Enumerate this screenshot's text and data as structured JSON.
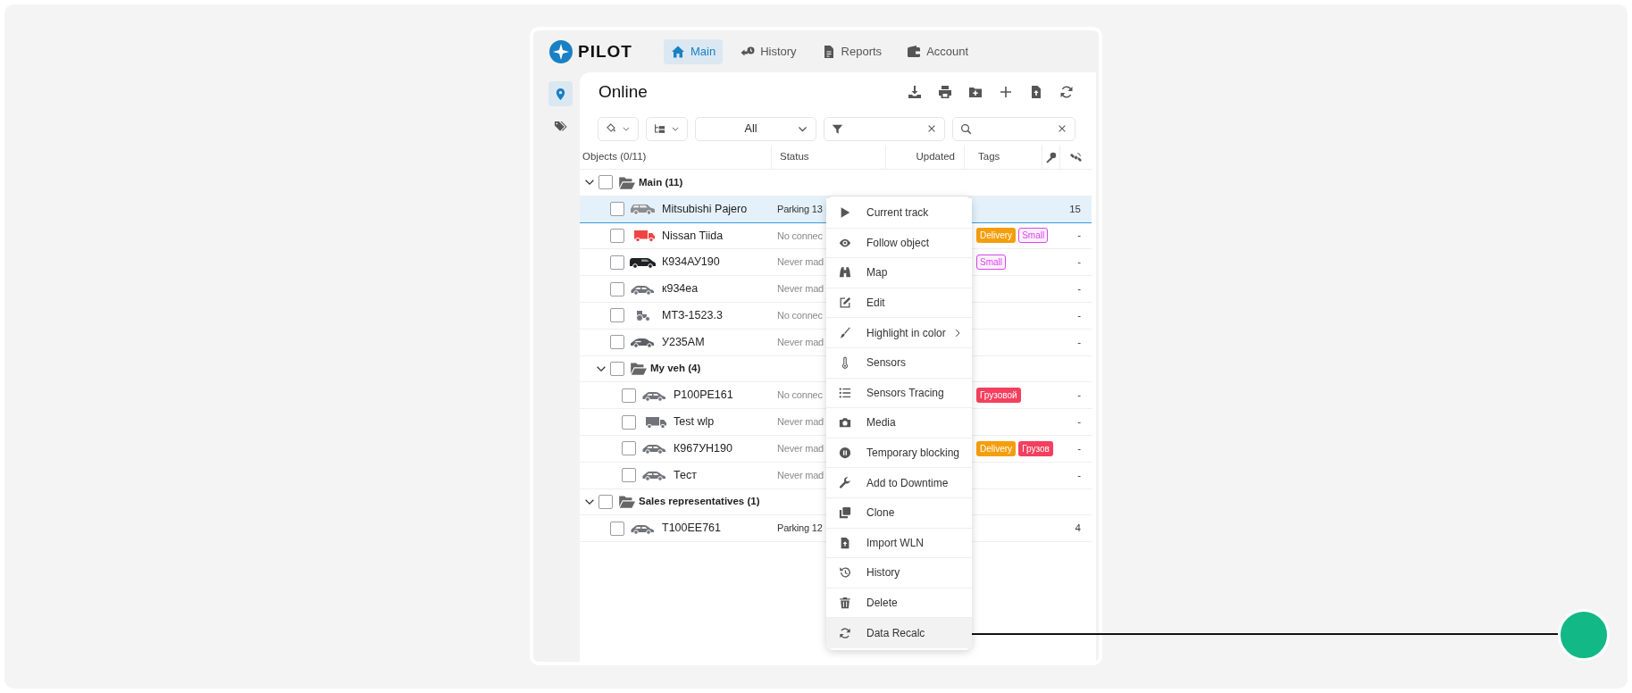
{
  "logo": {
    "text": "PILOT"
  },
  "nav_tabs": [
    {
      "label": "Main",
      "selected": true
    },
    {
      "label": "History",
      "selected": false
    },
    {
      "label": "Reports",
      "selected": false
    },
    {
      "label": "Account",
      "selected": false
    }
  ],
  "sidebar": {
    "items": [
      {
        "selected": true
      },
      {
        "selected": false
      }
    ]
  },
  "panel": {
    "title": "Online"
  },
  "filters": {
    "selector": "All"
  },
  "table": {
    "columns": [
      "Objects (0/11)",
      "Status",
      "Updated",
      "Tags"
    ],
    "rows": [
      {
        "kind": "group",
        "label": "Main (11)",
        "expanded": true,
        "checked": false,
        "children": [
          {
            "kind": "object",
            "name": "Mitsubishi Pajero",
            "color": "#8a8d93",
            "status": {
              "text": "Parking 13",
              "kind": "parking"
            },
            "value": "15",
            "checked": false,
            "selected": true
          },
          {
            "kind": "object",
            "name": "Nissan Tiida",
            "color": "#ef4444",
            "status": {
              "text": "No connec",
              "kind": "offline"
            },
            "tags": [
              {
                "text": "Delivery",
                "color": "#f59e0b",
                "kind": "solid"
              },
              {
                "text": "Small",
                "color": "#d946ef",
                "kind": "soft"
              }
            ],
            "value": "-",
            "checked": false,
            "selected": false
          },
          {
            "kind": "object",
            "name": "К934АУ190",
            "color": "#1f2023",
            "status": {
              "text": "Never mad",
              "kind": "offline"
            },
            "tags": [
              {
                "text": "Small",
                "color": "#d946ef",
                "kind": "soft"
              }
            ],
            "value": "-",
            "checked": false,
            "selected": false
          },
          {
            "kind": "object",
            "name": "к934еа",
            "color": "#71737a",
            "status": {
              "text": "Never mad",
              "kind": "offline"
            },
            "value": "-",
            "checked": false,
            "selected": false
          },
          {
            "kind": "object",
            "name": "МТЗ-1523.3",
            "color": "#71737a",
            "status": {
              "text": "No connec",
              "kind": "offline"
            },
            "value": "-",
            "checked": false,
            "selected": false
          },
          {
            "kind": "object",
            "name": "У235АМ",
            "color": "#5b5e66",
            "status": {
              "text": "Never mad",
              "kind": "offline"
            },
            "value": "-",
            "checked": false,
            "selected": false
          },
          {
            "kind": "group",
            "label": "My veh (4)",
            "expanded": true,
            "checked": false,
            "children": [
              {
                "kind": "object",
                "name": "Р100РЕ161",
                "color": "#71737a",
                "status": {
                  "text": "No connec",
                  "kind": "offline"
                },
                "tags": [
                  {
                    "text": "Грузовой",
                    "color": "#f43f5e",
                    "kind": "solid"
                  }
                ],
                "value": "-",
                "checked": false,
                "selected": false
              },
              {
                "kind": "object",
                "name": "Test wlp",
                "color": "#71737a",
                "status": {
                  "text": "Never mad",
                  "kind": "offline"
                },
                "value": "-",
                "checked": false,
                "selected": false
              },
              {
                "kind": "object",
                "name": "К967УН190",
                "color": "#71737a",
                "status": {
                  "text": "Never mad",
                  "kind": "offline"
                },
                "tags": [
                  {
                    "text": "Delivery",
                    "color": "#f59e0b",
                    "kind": "solid"
                  },
                  {
                    "text": "Грузов",
                    "color": "#f43f5e",
                    "kind": "solid"
                  }
                ],
                "value": "-",
                "checked": false,
                "selected": false
              },
              {
                "kind": "object",
                "name": "Тест",
                "color": "#71737a",
                "status": {
                  "text": "Never mad",
                  "kind": "offline"
                },
                "value": "-",
                "checked": false,
                "selected": false
              }
            ]
          }
        ]
      },
      {
        "kind": "group",
        "label": "Sales representatives (1)",
        "expanded": true,
        "checked": false,
        "children": [
          {
            "kind": "object",
            "name": "Т100ЕЕ761",
            "color": "#71737a",
            "status": {
              "text": "Parking 12",
              "kind": "parking"
            },
            "value": "4",
            "checked": false,
            "selected": false
          }
        ]
      }
    ]
  },
  "context_menu": {
    "items": [
      {
        "label": "Current track",
        "submenu": false,
        "hovered": false
      },
      {
        "label": "Follow object",
        "submenu": false,
        "hovered": false
      },
      {
        "label": "Map",
        "submenu": false,
        "hovered": false
      },
      {
        "label": "Edit",
        "submenu": false,
        "hovered": false
      },
      {
        "label": "Highlight in color",
        "submenu": true,
        "hovered": false
      },
      {
        "label": "Sensors",
        "submenu": false,
        "hovered": false
      },
      {
        "label": "Sensors Tracing",
        "submenu": false,
        "hovered": false
      },
      {
        "label": "Media",
        "submenu": false,
        "hovered": false
      },
      {
        "label": "Temporary blocking",
        "submenu": false,
        "hovered": false
      },
      {
        "label": "Add to Downtime",
        "submenu": false,
        "hovered": false
      },
      {
        "label": "Clone",
        "submenu": false,
        "hovered": false
      },
      {
        "label": "Import WLN",
        "submenu": false,
        "hovered": false
      },
      {
        "label": "History",
        "submenu": false,
        "hovered": false
      },
      {
        "label": "Delete",
        "submenu": false,
        "hovered": false
      },
      {
        "label": "Data Recalc",
        "submenu": false,
        "hovered": true
      }
    ]
  }
}
